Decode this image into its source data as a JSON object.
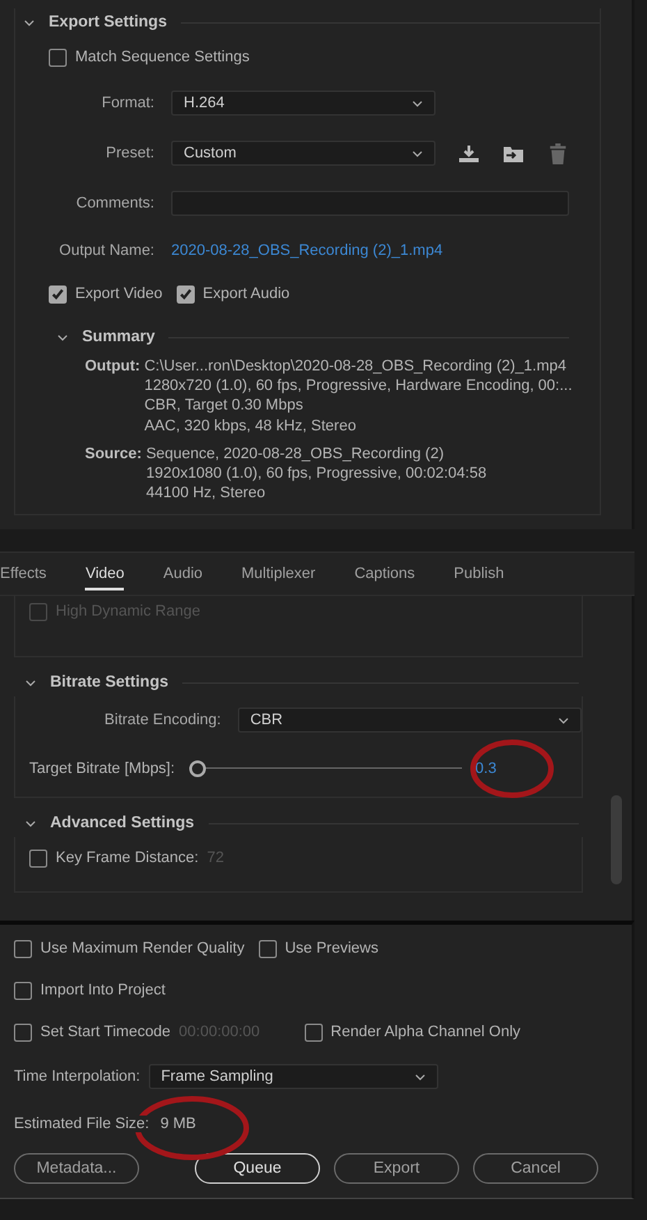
{
  "export_settings": {
    "title": "Export Settings",
    "expanded": true,
    "match_sequence": {
      "label": "Match Sequence Settings",
      "checked": false
    },
    "format": {
      "label": "Format:",
      "value": "H.264"
    },
    "preset": {
      "label": "Preset:",
      "value": "Custom"
    },
    "comments": {
      "label": "Comments:"
    },
    "output_name": {
      "label": "Output Name:",
      "value": "2020-08-28_OBS_Recording (2)_1.mp4"
    },
    "export_video": {
      "label": "Export Video",
      "checked": true
    },
    "export_audio": {
      "label": "Export Audio",
      "checked": true
    },
    "summary": {
      "title": "Summary",
      "expanded": true,
      "output": {
        "label": "Output:",
        "lines": [
          "C:\\User...ron\\Desktop\\2020-08-28_OBS_Recording (2)_1.mp4",
          "1280x720 (1.0), 60 fps, Progressive, Hardware Encoding, 00:...",
          "CBR, Target 0.30 Mbps",
          "AAC, 320 kbps, 48 kHz, Stereo"
        ]
      },
      "source": {
        "label": "Source:",
        "lines": [
          "Sequence, 2020-08-28_OBS_Recording (2)",
          "1920x1080 (1.0), 60 fps, Progressive, 00:02:04:58",
          "44100 Hz, Stereo"
        ]
      }
    }
  },
  "tabs": [
    {
      "label": "Effects",
      "selected": false
    },
    {
      "label": "Video",
      "selected": true
    },
    {
      "label": "Audio",
      "selected": false
    },
    {
      "label": "Multiplexer",
      "selected": false
    },
    {
      "label": "Captions",
      "selected": false
    },
    {
      "label": "Publish",
      "selected": false
    }
  ],
  "video": {
    "hdr": {
      "label": "High Dynamic Range",
      "checked": false,
      "disabled": true
    },
    "bitrate": {
      "title": "Bitrate Settings",
      "expanded": true,
      "encoding": {
        "label": "Bitrate Encoding:",
        "value": "CBR"
      },
      "target": {
        "label": "Target Bitrate [Mbps]:",
        "level": 0,
        "reading": "0.3"
      }
    },
    "advanced": {
      "title": "Advanced Settings",
      "expanded": true,
      "key_frame": {
        "label": "Key Frame Distance:",
        "checked": false,
        "value": "72"
      }
    }
  },
  "bottom": {
    "max_quality": {
      "label": "Use Maximum Render Quality",
      "checked": false
    },
    "use_previews": {
      "label": "Use Previews",
      "checked": false
    },
    "import_project": {
      "label": "Import Into Project",
      "checked": false
    },
    "start_timecode": {
      "label": "Set Start Timecode",
      "checked": false,
      "value": "00:00:00:00"
    },
    "alpha_only": {
      "label": "Render Alpha Channel Only",
      "checked": false
    },
    "time_interpolation": {
      "label": "Time Interpolation:",
      "value": "Frame Sampling"
    },
    "file_size": {
      "label": "Estimated File Size:",
      "value": "9 MB"
    },
    "buttons": [
      {
        "label": "Metadata...",
        "kind": "secondary"
      },
      {
        "label": "Queue",
        "kind": "primary"
      },
      {
        "label": "Export",
        "kind": "secondary"
      },
      {
        "label": "Cancel",
        "kind": "secondary"
      }
    ]
  }
}
